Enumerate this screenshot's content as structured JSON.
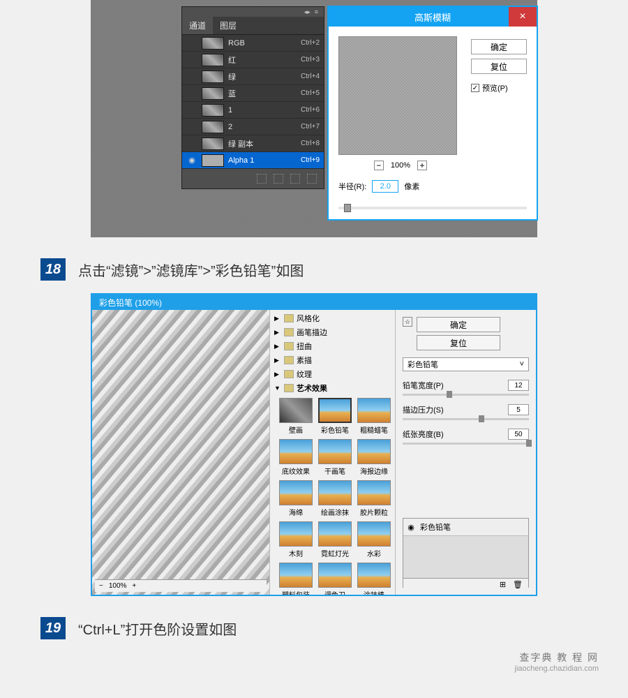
{
  "channels_panel": {
    "tabs": {
      "channels": "通道",
      "layers": "图层"
    },
    "rows": [
      {
        "name": "RGB",
        "shortcut": "Ctrl+2",
        "eye": ""
      },
      {
        "name": "红",
        "shortcut": "Ctrl+3",
        "eye": ""
      },
      {
        "name": "绿",
        "shortcut": "Ctrl+4",
        "eye": ""
      },
      {
        "name": "蓝",
        "shortcut": "Ctrl+5",
        "eye": ""
      },
      {
        "name": "1",
        "shortcut": "Ctrl+6",
        "eye": ""
      },
      {
        "name": "2",
        "shortcut": "Ctrl+7",
        "eye": ""
      },
      {
        "name": "绿 副本",
        "shortcut": "Ctrl+8",
        "eye": ""
      },
      {
        "name": "Alpha 1",
        "shortcut": "Ctrl+9",
        "eye": "◉",
        "selected": true
      }
    ]
  },
  "gaussian": {
    "title": "高斯模糊",
    "close": "×",
    "ok": "确定",
    "cancel": "复位",
    "preview_label": "预览(P)",
    "preview_checked": "✓",
    "zoom_minus": "−",
    "zoom_plus": "+",
    "zoom_value": "100%",
    "radius_label": "半径(R):",
    "radius_value": "2.0",
    "radius_unit": "像素"
  },
  "step18": {
    "num": "18",
    "text": "点击“滤镜”>”滤镜库”>”彩色铅笔”如图"
  },
  "filter_gallery": {
    "title": "彩色铅笔 (100%)",
    "ok": "确定",
    "cancel": "复位",
    "toggle": "☆",
    "zoom": "100%",
    "zoom_minus": "−",
    "zoom_plus": "+",
    "tree": [
      {
        "arrow": "▶",
        "label": "风格化"
      },
      {
        "arrow": "▶",
        "label": "画笔描边"
      },
      {
        "arrow": "▶",
        "label": "扭曲"
      },
      {
        "arrow": "▶",
        "label": "素描"
      },
      {
        "arrow": "▶",
        "label": "纹理"
      },
      {
        "arrow": "▼",
        "label": "艺术效果",
        "open": true
      }
    ],
    "thumbs": [
      {
        "label": "壁画",
        "bw": true
      },
      {
        "label": "彩色铅笔",
        "sel": true
      },
      {
        "label": "粗糙蜡笔"
      },
      {
        "label": "底纹效果"
      },
      {
        "label": "干画笔"
      },
      {
        "label": "海报边缘"
      },
      {
        "label": "海绵"
      },
      {
        "label": "绘画涂抹"
      },
      {
        "label": "胶片颗粒"
      },
      {
        "label": "木刻"
      },
      {
        "label": "霓虹灯光"
      },
      {
        "label": "水彩"
      },
      {
        "label": "塑料包装"
      },
      {
        "label": "调色刀"
      },
      {
        "label": "涂抹棒"
      }
    ],
    "effect_select": "彩色铅笔",
    "select_arrow": "˅",
    "params": [
      {
        "label": "铅笔宽度(P)",
        "value": "12",
        "pos": 35
      },
      {
        "label": "描边压力(S)",
        "value": "5",
        "pos": 60
      },
      {
        "label": "纸张亮度(B)",
        "value": "50",
        "pos": 98
      }
    ],
    "layer_eye": "◉",
    "layer_name": "彩色铅笔",
    "layer_new": "⊞",
    "layer_del": "🗑"
  },
  "step19": {
    "num": "19",
    "text": "“Ctrl+L”打开色阶设置如图"
  },
  "watermark": {
    "main": "查字典   教 程 网",
    "sub": "jiaocheng.chazidian.com"
  }
}
